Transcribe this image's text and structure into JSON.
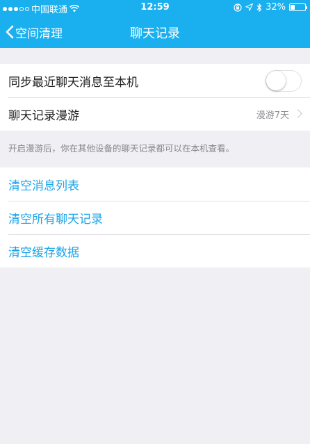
{
  "status_bar": {
    "carrier": "中国联通",
    "time": "12:59",
    "battery": "32%",
    "battery_level": 0.32,
    "signal_dots_filled": 3,
    "signal_dots_total": 5
  },
  "nav": {
    "back_label": "空间清理",
    "title": "聊天记录"
  },
  "settings": {
    "sync_label": "同步最近聊天消息至本机",
    "sync_enabled": false,
    "roaming_label": "聊天记录漫游",
    "roaming_value": "漫游7天",
    "hint": "开启漫游后，你在其他设备的聊天记录都可以在本机查看。"
  },
  "actions": [
    {
      "label": "清空消息列表"
    },
    {
      "label": "清空所有聊天记录"
    },
    {
      "label": "清空缓存数据"
    }
  ],
  "colors": {
    "accent": "#1ab0f0",
    "link": "#1aa3e8",
    "background": "#efeff4"
  }
}
